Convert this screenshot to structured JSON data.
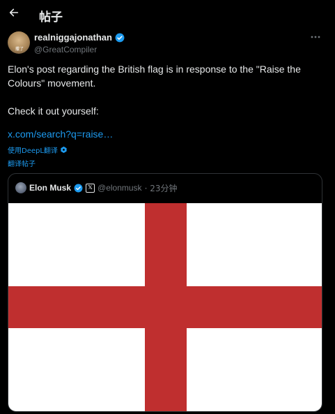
{
  "header": {
    "back_icon": "arrow-left-icon",
    "title": "帖子"
  },
  "post": {
    "author": {
      "name": "realniggajonathan",
      "handle": "@GreatCompiler",
      "verified": true,
      "avatar_caption": "撒了"
    },
    "text_lines": [
      "Elon's post regarding the British flag is in response to the \"Raise the Colours\" movement.",
      "Check it out yourself:"
    ],
    "link": "x.com/search?q=raise…",
    "deepl_label": "使用DeepL翻译",
    "translate_label": "翻译帖子"
  },
  "quote": {
    "name": "Elon Musk",
    "verified": true,
    "affiliation_badge": "𝕏",
    "handle": "@elonmusk",
    "time": "· 23分钟",
    "image": {
      "type": "flag-st-george",
      "background": "#ffffff",
      "cross_color": "#bf2f2f"
    }
  },
  "colors": {
    "accent": "#1d9bf0",
    "verified": "#1d9bf0",
    "text": "#e7e9ea",
    "muted": "#71767b",
    "border": "#2f3336"
  }
}
